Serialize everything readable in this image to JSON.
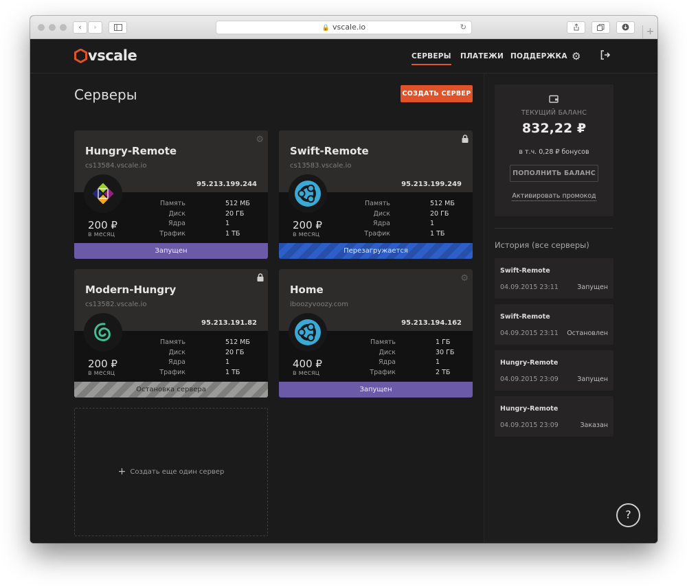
{
  "browser": {
    "url": "vscale.io",
    "back_icon": "‹",
    "forward_icon": "›",
    "new_tab_icon": "+"
  },
  "header": {
    "logo_text": "vscale",
    "nav": [
      {
        "label": "СЕРВЕРЫ",
        "active": true
      },
      {
        "label": "ПЛАТЕЖИ",
        "active": false
      },
      {
        "label": "ПОДДЕРЖКА",
        "active": false
      }
    ],
    "icons": [
      "gear-icon",
      "logout-icon"
    ]
  },
  "main": {
    "title": "Серверы",
    "create_button": "СОЗДАТЬ СЕРВЕР",
    "spec_labels": {
      "memory": "Память",
      "disk": "Диск",
      "cores": "Ядра",
      "traffic": "Трафик"
    },
    "period_label": "в месяц",
    "servers": [
      {
        "name": "Hungry-Remote",
        "host": "cs13584.vscale.io",
        "ip": "95.213.199.244",
        "os_icon": "centos-icon",
        "corner_icon": "gear-icon",
        "price": "200 ₽",
        "memory": "512 МБ",
        "disk": "20 ГБ",
        "cores": "1",
        "traffic": "1 ТБ",
        "status": "Запущен",
        "status_type": "running"
      },
      {
        "name": "Swift-Remote",
        "host": "cs13583.vscale.io",
        "ip": "95.213.199.249",
        "os_icon": "ubuntu-icon",
        "corner_icon": "lock-icon",
        "price": "200 ₽",
        "memory": "512 МБ",
        "disk": "20 ГБ",
        "cores": "1",
        "traffic": "1 ТБ",
        "status": "Перезагружается",
        "status_type": "reboot"
      },
      {
        "name": "Modern-Hungry",
        "host": "cs13582.vscale.io",
        "ip": "95.213.191.82",
        "os_icon": "debian-icon",
        "corner_icon": "lock-icon",
        "price": "200 ₽",
        "memory": "512 МБ",
        "disk": "20 ГБ",
        "cores": "1",
        "traffic": "1 ТБ",
        "status": "Остановка сервера",
        "status_type": "stopping"
      },
      {
        "name": "Home",
        "host": "iboozyvoozy.com",
        "ip": "95.213.194.162",
        "os_icon": "ubuntu-icon",
        "corner_icon": "gear-icon",
        "price": "400 ₽",
        "memory": "1 ГБ",
        "disk": "30 ГБ",
        "cores": "1",
        "traffic": "2 ТБ",
        "status": "Запущен",
        "status_type": "running"
      }
    ],
    "add_server_label": "Создать еще один сервер"
  },
  "sidebar": {
    "balance_label": "ТЕКУЩИЙ БАЛАНС",
    "balance_amount": "832,22 ₽",
    "bonus_text": "в т.ч. 0,28 ₽ бонусов",
    "topup_button": "ПОПОЛНИТЬ БАЛАНС",
    "promo_link": "Активировать промокод",
    "history_title": "История (все серверы)",
    "history": [
      {
        "server": "Swift-Remote",
        "time": "04.09.2015 23:11",
        "state": "Запущен"
      },
      {
        "server": "Swift-Remote",
        "time": "04.09.2015 23:11",
        "state": "Остановлен"
      },
      {
        "server": "Hungry-Remote",
        "time": "04.09.2015 23:09",
        "state": "Запущен"
      },
      {
        "server": "Hungry-Remote",
        "time": "04.09.2015 23:09",
        "state": "Заказан"
      }
    ]
  },
  "help_button": "?",
  "colors": {
    "accent": "#e0522a",
    "running": "#6b5aa7",
    "reboot": "#2e5fc8",
    "stopping": "#8d8d8b",
    "background": "#1b1b1b"
  }
}
